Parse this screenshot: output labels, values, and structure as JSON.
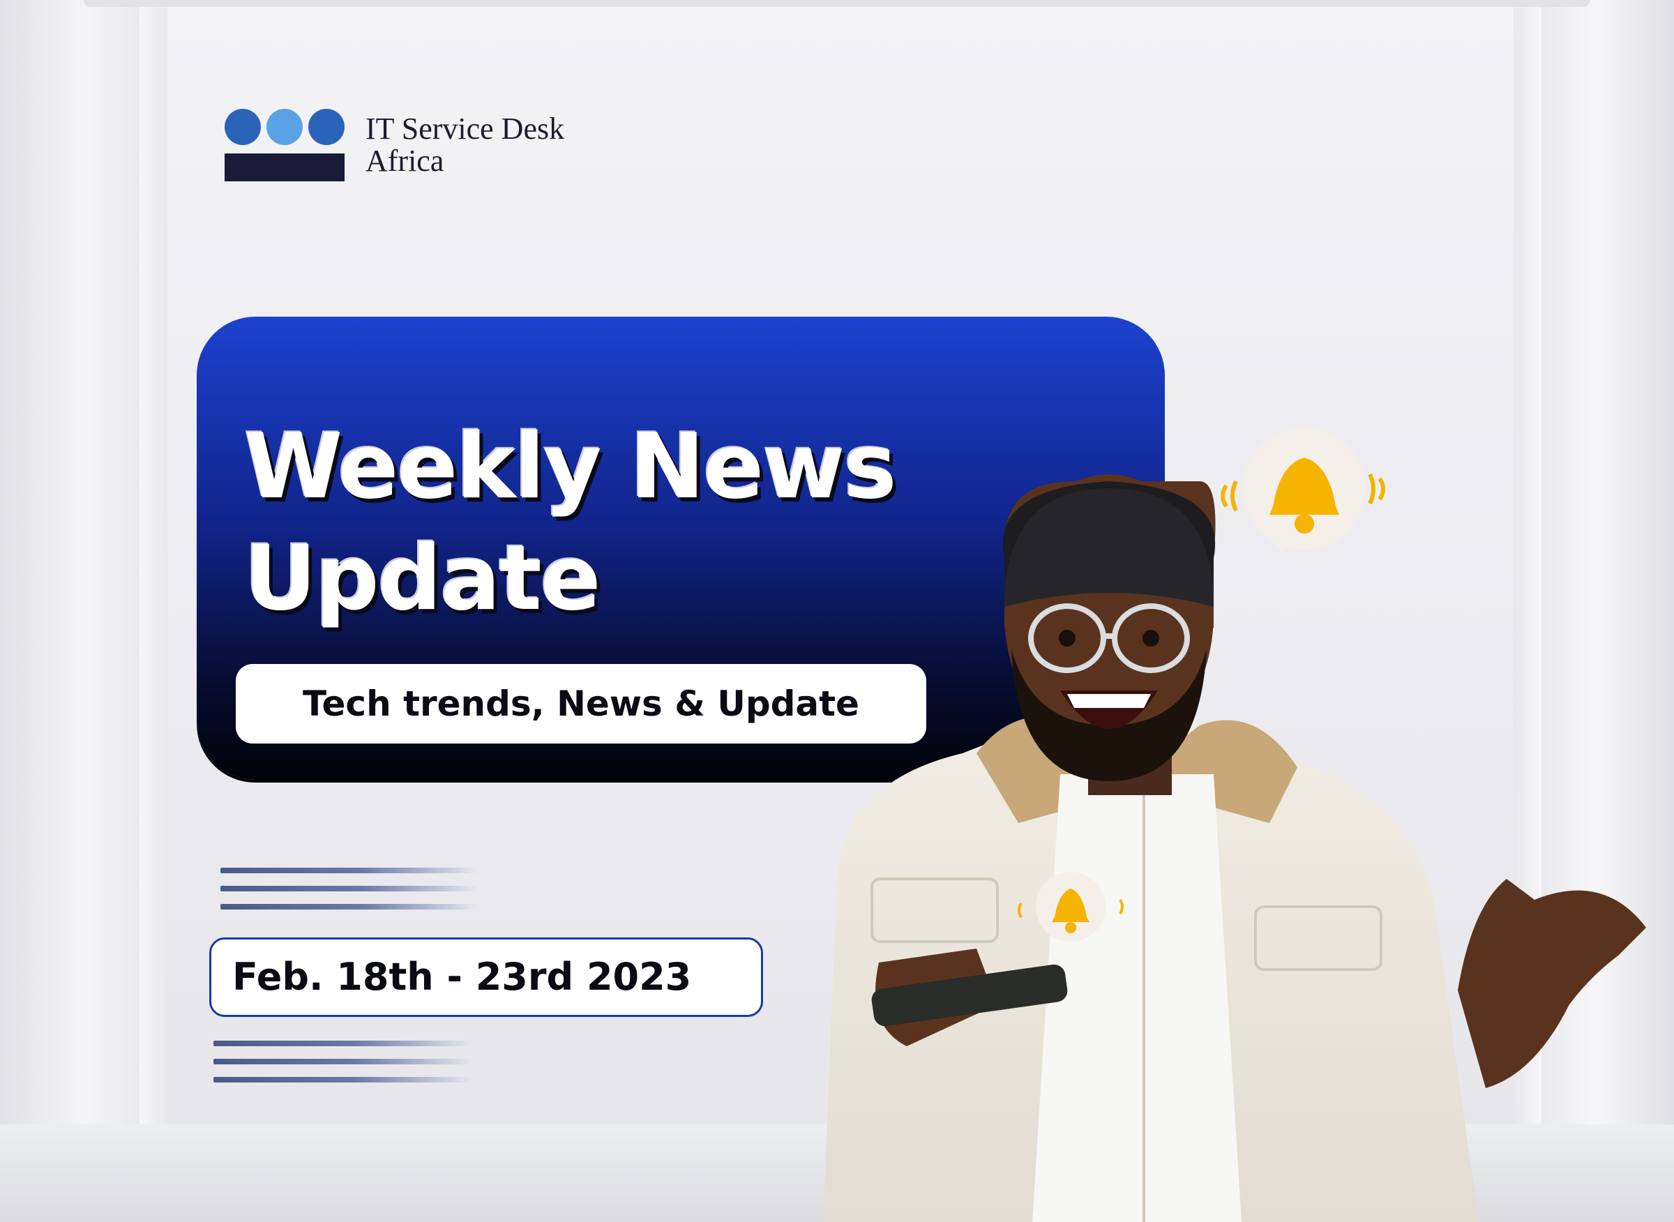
{
  "brand": {
    "name_line1": "IT Service Desk",
    "name_line2": "Africa",
    "dot_colors": [
      "#2b63b8",
      "#5aa2e6",
      "#2b63b8"
    ]
  },
  "headline": {
    "line1": "Weekly News",
    "line2": "Update"
  },
  "tagline": "Tech trends, News & Update",
  "date_range": "Feb. 18th -  23rd 2023",
  "colors": {
    "card_top": "#1d42cf",
    "card_bottom": "#02030a",
    "accent_border": "#1b3aa8",
    "bell": "#f6b300"
  },
  "icons": [
    "bell-icon",
    "bell-icon"
  ]
}
